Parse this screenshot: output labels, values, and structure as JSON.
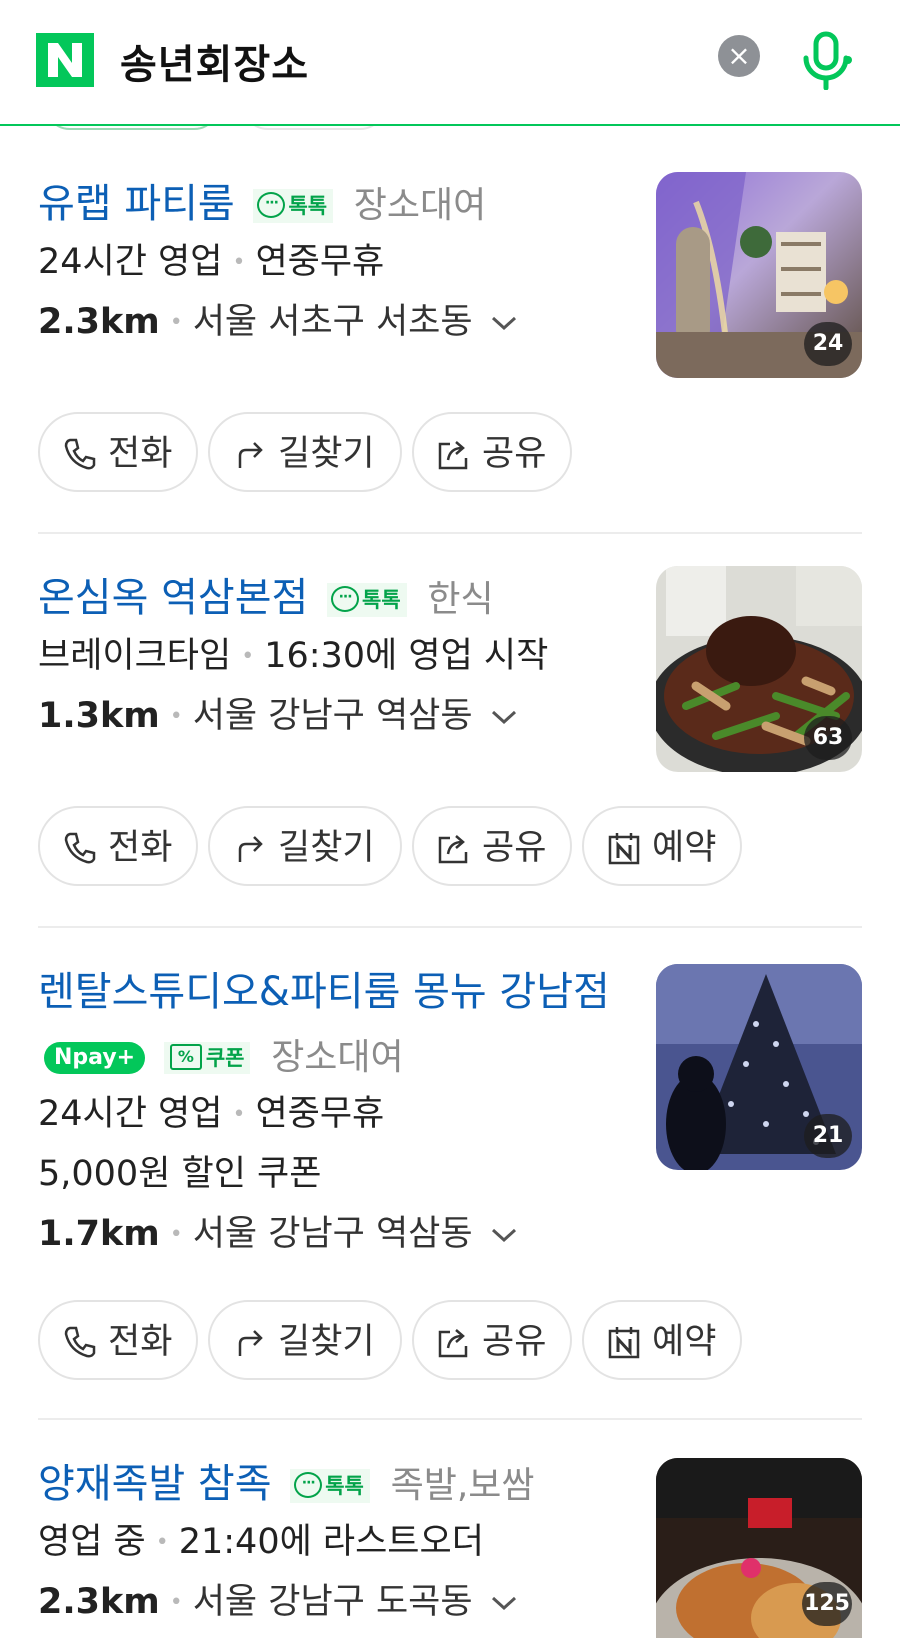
{
  "search": {
    "query": "송년회장소",
    "clear_label": "×"
  },
  "actions": {
    "call": "전화",
    "directions": "길찾기",
    "share": "공유",
    "reserve": "예약"
  },
  "colors": {
    "brand": "#03c75a",
    "link": "#0c5fb5",
    "talk": "#03a34a"
  },
  "results": [
    {
      "name": "유랩 파티룸",
      "talk_badge": "톡톡",
      "category": "장소대여",
      "status": "24시간 영업",
      "status_extra": "연중무휴",
      "distance": "2.3km",
      "address": "서울 서초구 서초동",
      "photo_count": "24",
      "buttons": [
        "call",
        "directions",
        "share"
      ]
    },
    {
      "name": "온심옥 역삼본점",
      "talk_badge": "톡톡",
      "category": "한식",
      "status": "브레이크타임",
      "status_extra": "16:30에 영업 시작",
      "distance": "1.3km",
      "address": "서울 강남구 역삼동",
      "photo_count": "63",
      "buttons": [
        "call",
        "directions",
        "share",
        "reserve"
      ]
    },
    {
      "name": "렌탈스튜디오&파티룸 몽뉴 강남점",
      "npay_badge": "Npay+",
      "coupon_badge": "쿠폰",
      "category": "장소대여",
      "status": "24시간 영업",
      "status_extra": "연중무휴",
      "coupon_text": "5,000원 할인 쿠폰",
      "distance": "1.7km",
      "address": "서울 강남구 역삼동",
      "photo_count": "21",
      "buttons": [
        "call",
        "directions",
        "share",
        "reserve"
      ]
    },
    {
      "name": "양재족발 참족",
      "talk_badge": "톡톡",
      "category": "족발,보쌈",
      "status": "영업 중",
      "status_extra": "21:40에 라스트오더",
      "distance": "2.3km",
      "address": "서울 강남구 도곡동",
      "photo_count": "125"
    }
  ]
}
